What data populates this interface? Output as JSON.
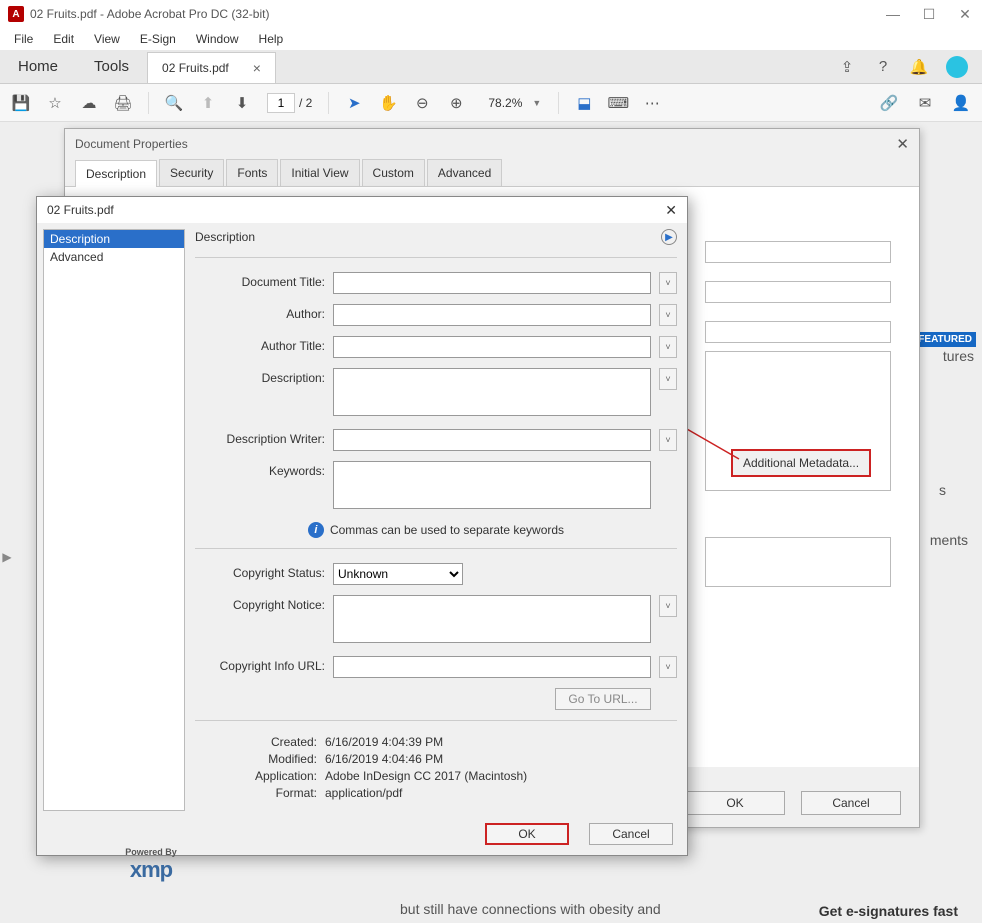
{
  "titlebar": {
    "title": "02 Fruits.pdf - Adobe Acrobat Pro DC (32-bit)"
  },
  "menubar": {
    "items": [
      "File",
      "Edit",
      "View",
      "E-Sign",
      "Window",
      "Help"
    ]
  },
  "tabstrip": {
    "home": "Home",
    "tools": "Tools",
    "doc_tab": "02 Fruits.pdf"
  },
  "toolbar": {
    "page_current": "1",
    "page_total": "/ 2",
    "zoom": "78.2%"
  },
  "docprops": {
    "title": "Document Properties",
    "tabs": [
      "Description",
      "Security",
      "Fonts",
      "Initial View",
      "Custom",
      "Advanced"
    ],
    "ok": "OK",
    "cancel": "Cancel",
    "additional": "Additional Metadata..."
  },
  "xmp": {
    "title": "02 Fruits.pdf",
    "sidebar": [
      "Description",
      "Advanced"
    ],
    "section": "Description",
    "labels": {
      "doc_title": "Document Title:",
      "author": "Author:",
      "author_title": "Author Title:",
      "description": "Description:",
      "desc_writer": "Description Writer:",
      "keywords": "Keywords:",
      "copyright_status": "Copyright Status:",
      "copyright_notice": "Copyright Notice:",
      "copyright_url": "Copyright Info URL:",
      "created": "Created:",
      "modified": "Modified:",
      "application": "Application:",
      "format": "Format:"
    },
    "info_hint": "Commas can be used to separate keywords",
    "copyright_status_value": "Unknown",
    "go_to_url": "Go To URL...",
    "created_val": "6/16/2019 4:04:39 PM",
    "modified_val": "6/16/2019 4:04:46 PM",
    "application_val": "Adobe InDesign CC 2017 (Macintosh)",
    "format_val": "application/pdf",
    "logo_small": "Powered By",
    "logo_big": "xmp",
    "ok": "OK",
    "cancel": "Cancel"
  },
  "background": {
    "snippet": "but still have connections with obesity and",
    "featured": "FEATURED",
    "tures": "tures",
    "s": "s",
    "ments": "ments",
    "esig": "Get e-signatures fast"
  }
}
